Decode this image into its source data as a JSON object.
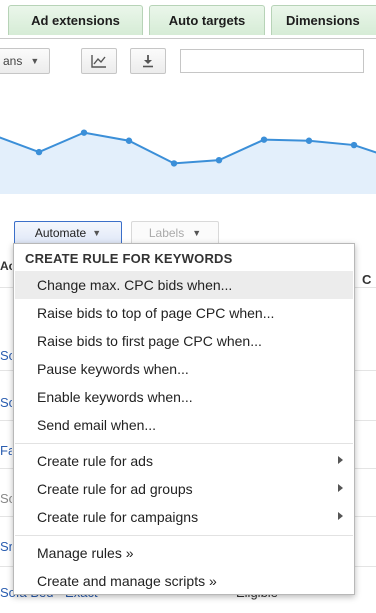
{
  "tabs": [
    {
      "label": "Ad extensions"
    },
    {
      "label": "Auto targets"
    },
    {
      "label": "Dimensions"
    }
  ],
  "toolbar": {
    "segment_label": "ans",
    "search_value": ""
  },
  "chart_data": {
    "type": "area",
    "series_color": "#3b8fd8",
    "fill_color": "#e3effb",
    "values": [
      0.79,
      0.48,
      0.84,
      0.69,
      0.27,
      0.33,
      0.71,
      0.69,
      0.61,
      0.33
    ]
  },
  "automate_bar": {
    "automate_label": "Automate",
    "labels_label": "Labels"
  },
  "background": {
    "col_header_left": "Ac",
    "col_header_right": "C",
    "left_fragments": [
      "So",
      "So",
      "Fa",
      "So",
      "Sr"
    ],
    "bottom_keyword": "Sofa Bed - Exact",
    "bottom_status": "Eligible"
  },
  "menu": {
    "header": "CREATE RULE FOR KEYWORDS",
    "rule_items": [
      "Change max. CPC bids when...",
      "Raise bids to top of page CPC when...",
      "Raise bids to first page CPC when...",
      "Pause keywords when...",
      "Enable keywords when...",
      "Send email when..."
    ],
    "submenu_items": [
      "Create rule for ads",
      "Create rule for ad groups",
      "Create rule for campaigns"
    ],
    "manage_items": [
      "Manage rules »",
      "Create and manage scripts »"
    ]
  }
}
